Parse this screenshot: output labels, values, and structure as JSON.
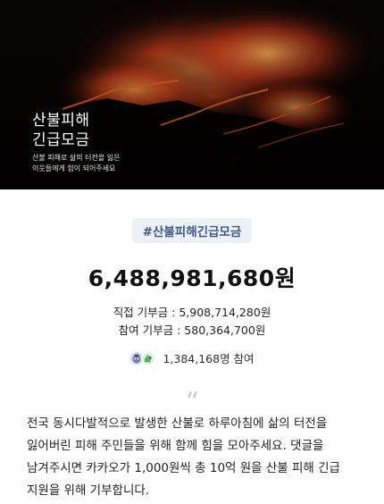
{
  "hero": {
    "title_line1": "산불피해",
    "title_line2": "긴급모금",
    "subtitle_line1": "산불 피해로 삶의 터전을 잃은",
    "subtitle_line2": "이웃들에게 힘이 되어주세요"
  },
  "campaign": {
    "hashtag": "#산불피해긴급모금",
    "total_amount": "6,488,981,680원",
    "direct_donation": "직접 기부금 : 5,908,714,280원",
    "participation_donation": "참여 기부금 : 580,364,700원",
    "participants": "1,384,168명 참여"
  },
  "story": {
    "quote_mark": "“",
    "text": "전국 동시다발적으로 발생한 산불로 하루아침에 삶의 터전을 잃어버린 피해 주민들을 위해 함께 힘을 모아주세요. 댓글을 남겨주시면 카카오가 1,000원씩 총 10억 원을 산불 피해 긴급 지원을 위해 기부합니다."
  },
  "colors": {
    "hashtag_bg": "#edf0f4",
    "hashtag_text": "#3e5a8a",
    "hero_bg": "#050302",
    "fire": "#e0421a"
  },
  "icons": [
    "hero-wildfire-image",
    "avatar-character-icon",
    "avatar-dino-icon"
  ]
}
